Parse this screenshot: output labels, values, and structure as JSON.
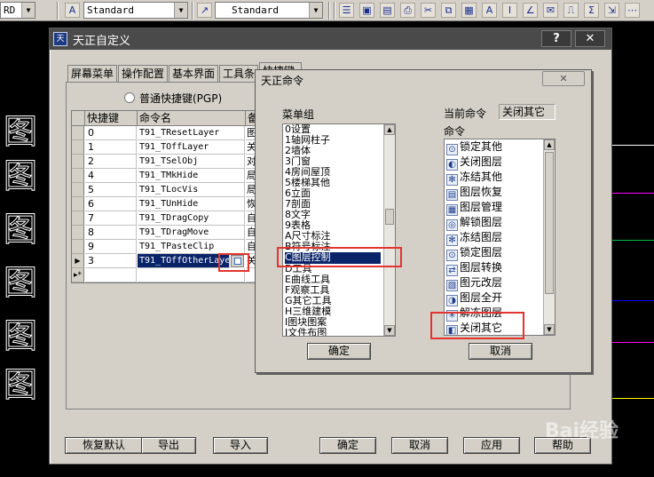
{
  "toolbar": {
    "left_combo": "RD",
    "style_combo_1": "Standard",
    "style_combo_2": "Standard",
    "icons": [
      "properties-icon",
      "open-icon",
      "save-icon",
      "print-icon",
      "cut-icon",
      "copy-icon",
      "paste-icon",
      "text-icon",
      "dimension-icon",
      "mail-icon",
      "ruler-icon",
      "formula-icon"
    ]
  },
  "cad": {
    "glyph": "图",
    "line_colors": [
      "#ffffff",
      "#ff00ff",
      "#00c040",
      "#0000ff",
      "#ff00ff",
      "#ffff00"
    ]
  },
  "main_window": {
    "title": "天正自定义",
    "help_label": "?",
    "close_label": "✕",
    "tabs": [
      "屏幕菜单",
      "操作配置",
      "基本界面",
      "工具条",
      "快捷键"
    ],
    "radio_label": "普通快捷键(PGP)",
    "grid": {
      "columns": [
        "快捷键",
        "命令名",
        "备"
      ],
      "rows": [
        {
          "key": "0",
          "cmd": "T91_TResetLayer",
          "note": "图"
        },
        {
          "key": "1",
          "cmd": "T91_TOffLayer",
          "note": "关"
        },
        {
          "key": "2",
          "cmd": "T91_TSelObj",
          "note": "对"
        },
        {
          "key": "4",
          "cmd": "T91_TMkHide",
          "note": "局"
        },
        {
          "key": "5",
          "cmd": "T91_TLocVis",
          "note": "局"
        },
        {
          "key": "6",
          "cmd": "T91_TUnHide",
          "note": "恢"
        },
        {
          "key": "7",
          "cmd": "T91_TDragCopy",
          "note": "自"
        },
        {
          "key": "8",
          "cmd": "T91_TDragMove",
          "note": "自"
        },
        {
          "key": "9",
          "cmd": "T91_TPasteClip",
          "note": "自"
        },
        {
          "key": "3",
          "cmd": "T91_TOffOtherLaye",
          "note": "关"
        }
      ],
      "new_row_marker": "▸*"
    },
    "buttons": {
      "restore": "恢复默认",
      "export": "导出",
      "import": "导入",
      "ok": "确定",
      "cancel": "取消",
      "apply": "应用",
      "help": "帮助"
    }
  },
  "cmd_dialog": {
    "title": "天正命令",
    "close_label": "✕",
    "menu_group_label": "菜单组",
    "current_cmd_label": "当前命令",
    "current_cmd_value": "关闭其它",
    "command_label": "命令",
    "menu_groups": [
      "0设置",
      "1轴网柱子",
      "2墙体",
      "3门窗",
      "4房间屋顶",
      "5楼梯其他",
      "6立面",
      "7剖面",
      "8文字",
      "9表格",
      "A尺寸标注",
      "B符号标注",
      "C图层控制",
      "D工具",
      "E曲线工具",
      "F观察工具",
      "G其它工具",
      "H三维建模",
      "I图块图案",
      "J文件布图"
    ],
    "selected_group": "C图层控制",
    "commands": [
      "锁定其他",
      "关闭图层",
      "冻结其他",
      "图层恢复",
      "图层管理",
      "解锁图层",
      "冻结图层",
      "锁定图层",
      "图层转换",
      "图元改层",
      "图层全开",
      "解冻图层",
      "关闭其它"
    ],
    "ok_label": "确定",
    "cancel_label": "取消"
  },
  "watermark": "Bai经验"
}
